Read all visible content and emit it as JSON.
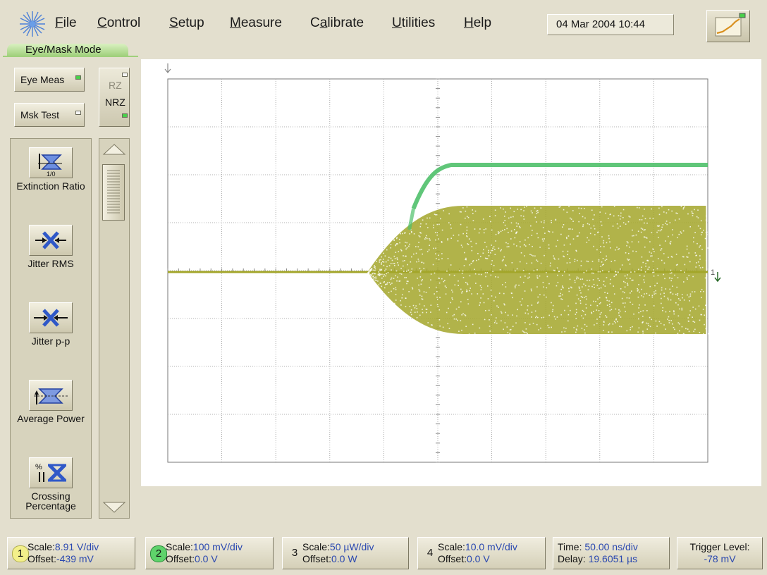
{
  "menubar": {
    "items": [
      {
        "label": "File",
        "ul": "F"
      },
      {
        "label": "Control",
        "ul": "C"
      },
      {
        "label": "Setup",
        "ul": "S"
      },
      {
        "label": "Measure",
        "ul": "M"
      },
      {
        "label": "Calibrate",
        "ul": "a"
      },
      {
        "label": "Utilities",
        "ul": "U"
      },
      {
        "label": "Help",
        "ul": "H"
      }
    ],
    "datetime": "04 Mar 2004   10:44"
  },
  "mode": {
    "tab_label": "Eye/Mask Mode"
  },
  "mode_buttons": {
    "eye_meas": "Eye Meas",
    "mask_test": "Msk Test"
  },
  "format": {
    "rz": "RZ",
    "nrz": "NRZ"
  },
  "tools": [
    {
      "label": "Extinction Ratio",
      "icon": "extinction-ratio-icon",
      "sub": "1/0"
    },
    {
      "label": "Jitter RMS",
      "icon": "jitter-rms-icon"
    },
    {
      "label": "Jitter p-p",
      "icon": "jitter-pp-icon"
    },
    {
      "label": "Average Power",
      "icon": "average-power-icon"
    },
    {
      "label": "Crossing Percentage",
      "icon": "crossing-percentage-icon"
    }
  ],
  "channels": [
    {
      "num": "1",
      "color": "#f3f08a",
      "scale_label": "Scale:",
      "scale": "8.91 V/div",
      "offset_label": "Offset:",
      "offset": "-439 mV"
    },
    {
      "num": "2",
      "color": "#5fd36b",
      "scale_label": "Scale:",
      "scale": "100 mV/div",
      "offset_label": "Offset:",
      "offset": "0.0 V"
    },
    {
      "num": "3",
      "color": "#e8e4d2",
      "scale_label": "Scale:",
      "scale": "50 µW/div",
      "offset_label": "Offset:",
      "offset": "0.0 W"
    },
    {
      "num": "4",
      "color": "#e8e4d2",
      "scale_label": "Scale:",
      "scale": "10.0 mV/div",
      "offset_label": "Offset:",
      "offset": "0.0 V"
    }
  ],
  "timebase": {
    "time_label": "Time:",
    "time": "50.00 ns/div",
    "delay_label": "Delay:",
    "delay": "19.6051 µs"
  },
  "trigger": {
    "label": "Trigger Level:",
    "value": "-78 mV"
  },
  "colors": {
    "noise_trace": "#a3a62a",
    "green_trace": "#4fc06a",
    "grid": "#8c8c8c",
    "value_text": "#2a48b0"
  }
}
